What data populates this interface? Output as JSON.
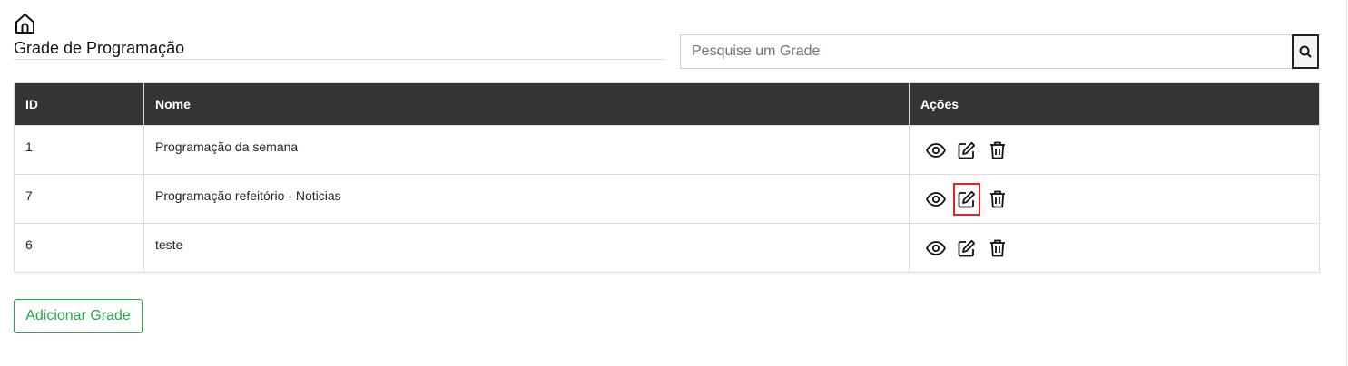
{
  "header": {
    "home_icon": "home-icon",
    "title": "Grade de Programação"
  },
  "search": {
    "placeholder": "Pesquise um Grade",
    "value": "",
    "button_icon": "search-icon"
  },
  "table": {
    "columns": [
      "ID",
      "Nome",
      "Ações"
    ],
    "rows": [
      {
        "id": "1",
        "name": "Programação da semana",
        "actions": [
          "view-icon",
          "edit-icon",
          "delete-icon"
        ]
      },
      {
        "id": "7",
        "name": "Programação refeitório - Noticias",
        "actions": [
          "view-icon",
          "edit-icon",
          "delete-icon"
        ]
      },
      {
        "id": "6",
        "name": "teste",
        "actions": [
          "view-icon",
          "edit-icon",
          "delete-icon"
        ]
      }
    ],
    "header_color": "#343434"
  },
  "add_button": {
    "label": "Adicionar Grade",
    "color": "#28a745"
  },
  "highlight_color": "#e02424"
}
